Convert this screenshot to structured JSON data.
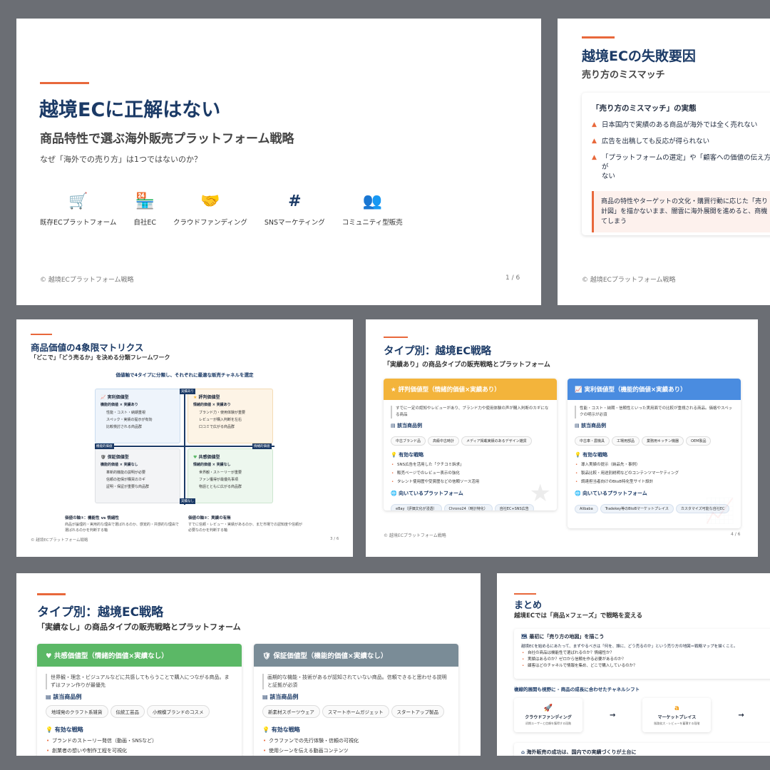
{
  "slide1": {
    "title": "越境ECに正解はない",
    "subtitle": "商品特性で選ぶ海外販売プラットフォーム戦略",
    "question": "なぜ「海外での売り方」は1つではないのか？",
    "icons": [
      {
        "icon": "cart-icon",
        "glyph": "🛒",
        "label": "既存ECプラットフォーム"
      },
      {
        "icon": "store-icon",
        "glyph": "🏪",
        "label": "自社EC"
      },
      {
        "icon": "handshake-icon",
        "glyph": "🤝",
        "label": "クラウドファンディング"
      },
      {
        "icon": "hashtag-icon",
        "glyph": "#",
        "label": "SNSマーケティング"
      },
      {
        "icon": "users-icon",
        "glyph": "👥",
        "label": "コミュニティ型販売"
      }
    ],
    "footer": "© 越境ECプラットフォーム戦略",
    "page": "1 / 6"
  },
  "slide2": {
    "title": "越境ECの失敗要因",
    "subtitle": "売り方のミスマッチ",
    "box_title": "「売り方のミスマッチ」の実態",
    "warnings": [
      "日本国内で実績のある商品が海外では全く売れない",
      "広告を出稿しても反応が得られない",
      "「プラットフォームの選定」や「顧客への価値の伝え方」が\nない"
    ],
    "note": "商品の特性やターゲットの文化・購買行動に応じた「売り\n計図」を描かないまま、闇雲に海外展開を進めると、商機\nてしまう",
    "footer": "© 越境ECプラットフォーム戦略"
  },
  "slide3": {
    "title": "商品価値の4象限マトリクス",
    "subtitle": "「どこで」「どう売るか」を決める分類フレームワーク",
    "lead": "価値軸で4タイプに分類し、それぞれに最適な販売チャネルを選定",
    "axis_top": "実績あり",
    "axis_bottom": "実績なし",
    "axis_left": "機能的価値",
    "axis_right": "情緒的価値",
    "quadrants": [
      {
        "name": "実利価値型",
        "sub": "機能的価値 × 実績あり",
        "items": [
          "性能・コスト・納期重視",
          "スペック・実績の提示が有効",
          "比較検討される商品群"
        ],
        "bg": "#eef4fb",
        "border": "#c9dcef"
      },
      {
        "name": "評判価値型",
        "sub": "情緒的価値 × 実績あり",
        "items": [
          "ブランド力・使用体験が重要",
          "レビューが購入判断を左右",
          "口コミで広がる商品群"
        ],
        "bg": "#fdf4e6",
        "border": "#f3dbb4"
      },
      {
        "name": "保証価値型",
        "sub": "機能的価値 × 実績なし",
        "items": [
          "革新的機能の説明が必要",
          "信頼の担保が購買のカギ",
          "証明・保証が重要な商品群"
        ],
        "bg": "#f3f4f6",
        "border": "#dcdfe3"
      },
      {
        "name": "共感価値型",
        "sub": "情緒的価値 × 実績なし",
        "items": [
          "世界観・ストーリーが重要",
          "ファン獲得が最優先事項",
          "物語とともに広がる商品群"
        ],
        "bg": "#edf7ee",
        "border": "#cde6cf"
      }
    ],
    "axis_note1_title": "価値の軸①：機能性 vs 情緒性",
    "axis_note1": "商品が論理的・実用的な理由で選ばれるのか、感覚的・共感的な理由で選ばれるのかを判断する軸",
    "axis_note2_title": "価値の軸②：実績の有無",
    "axis_note2": "すでに信頼・レビュー・実績があるのか、まだ市場での認知度や信頼が必要なのかを判断する軸",
    "footer": "© 越境ECプラットフォーム戦略",
    "page": "3 / 6"
  },
  "slide4": {
    "title": "タイプ別：越境EC戦略",
    "subtitle": "「実績あり」の商品タイプの販売戦略とプラットフォーム",
    "cards": [
      {
        "header": "評判価値型（情緒的価値×実績あり）",
        "icon": "star-icon",
        "glyph": "★",
        "color": "#f3b43b",
        "desc": "すでに一定の認知やレビューがあり、ブランド力や使用体験の声が購入判断のカギになる商品",
        "products_title": "該当商品例",
        "products": [
          "中古ブランド品",
          "高級中古時計",
          "メディア掲載実績のあるデザイン雑貨"
        ],
        "strategy_title": "有効な戦略",
        "strategies": [
          "SNS広告を活用した「クチコミ訴求」",
          "販売ページでのレビュー表示の強化",
          "タレント使用歴や受賞歴などの信頼ソース活用"
        ],
        "platform_title": "向いているプラットフォーム",
        "platforms": [
          "eBay（評価文化が浸透）",
          "Chrono24（時計特化）",
          "自社EC+SNS広告"
        ]
      },
      {
        "header": "実利価値型（機能的価値×実績あり）",
        "icon": "chart-icon",
        "glyph": "📈",
        "color": "#4a8ce0",
        "desc": "性能・コスト・納期・信頼性といった実用面での比較が重視される商品。価格やスペックの明示が必須",
        "products_title": "該当商品例",
        "products": [
          "中古車・農機具",
          "工場用部品",
          "業務用キッチン機器",
          "OEM製品"
        ],
        "strategy_title": "有効な戦略",
        "strategies": [
          "導入実績の提示（納品先・事例）",
          "製品比較・用途別説明などのコンテンツマーケティング",
          "調達担当者向けのBtoB特化型サイト設計"
        ],
        "platform_title": "向いているプラットフォーム",
        "platforms": [
          "Alibaba",
          "Tradekey等のBtoBマーケットプレイス",
          "カスタマイズ可能な自社EC"
        ]
      }
    ],
    "footer": "© 越境ECプラットフォーム戦略",
    "page": "4 / 6"
  },
  "slide5": {
    "title": "タイプ別：越境EC戦略",
    "subtitle": "「実績なし」の商品タイプの販売戦略とプラットフォーム",
    "cards": [
      {
        "header": "共感価値型（情緒的価値×実績なし）",
        "glyph": "♥",
        "color": "#5bb866",
        "desc": "世界観・理念・ビジュアルなどに共感してもらうことで購入につながる商品。まずはファン作りが最優先",
        "products_title": "該当商品例",
        "products": [
          "地域発のクラフト系雑貨",
          "伝統工芸品",
          "小規模ブランドのコスメ"
        ],
        "strategy_title": "有効な戦略",
        "strategies": [
          "ブランドのストーリー発信（動画・SNSなど）",
          "創業者の想いや制作工程を可視化"
        ]
      },
      {
        "header": "保証価値型（機能的価値×実績なし）",
        "glyph": "🛡",
        "color": "#7a8c97",
        "desc": "画期的な機能・技術があるが認知されていない商品。信頼できると思わせる説明と証拠が必須",
        "products_title": "該当商品例",
        "products": [
          "新素材スポーツウェア",
          "スマートホームガジェット",
          "スタートアップ製品"
        ],
        "strategy_title": "有効な戦略",
        "strategies": [
          "クラファンでの先行体験・信頼の可視化",
          "使用シーンを伝える動画コンテンツ"
        ]
      }
    ]
  },
  "slide6": {
    "title": "まとめ",
    "subtitle": "越境ECでは「商品×フェーズ」で戦略を変える",
    "box1_title": "最初に「売り方の地図」を描こう",
    "box1_lead": "越境ECを始めるにあたって、まずやるべきは「何を、誰に、どう売るのか」という売り方の地図＝戦略マップを描くこと。",
    "box1_items": [
      "自社の商品は機能性で選ばれるのか？情緒性か？",
      "実績はあるのか？ゼロから信頼を作る必要があるのか？",
      "顧客はどのチャネルで情報を集め、どこで購入しているのか？"
    ],
    "shift_title": "複線的展開も視野に - 商品の成長に合わせたチャネルシフト",
    "steps": [
      {
        "icon": "rocket-icon",
        "glyph": "🚀",
        "title": "クラウドファンディング",
        "desc": "初期ユーザーと信頼を獲得する段階"
      },
      {
        "icon": "amazon-icon",
        "glyph": "a",
        "title": "マーケットプレイス",
        "desc": "販路拡大・レビューを蓄積する段階"
      }
    ],
    "arrow": "→",
    "box2_title": "海外販売の成功は、国内での実績づくりが土台に"
  }
}
